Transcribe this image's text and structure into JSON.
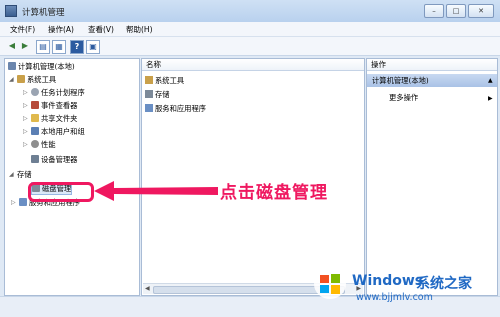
{
  "window": {
    "title": "计算机管理",
    "buttons": [
      "–",
      "□",
      "✕"
    ]
  },
  "menu": [
    {
      "label": "文件(F)"
    },
    {
      "label": "操作(A)"
    },
    {
      "label": "查看(V)"
    },
    {
      "label": "帮助(H)"
    }
  ],
  "tree": {
    "root": "计算机管理(本地)",
    "items": [
      {
        "label": "系统工具"
      },
      {
        "label": "任务计划程序"
      },
      {
        "label": "事件查看器"
      },
      {
        "label": "共享文件夹"
      },
      {
        "label": "本地用户和组"
      },
      {
        "label": "性能"
      },
      {
        "label": "设备管理器"
      },
      {
        "label": "存储"
      },
      {
        "label": "磁盘管理"
      },
      {
        "label": "服务和应用程序"
      }
    ]
  },
  "center": {
    "column_header": "名称",
    "rows": [
      {
        "label": "系统工具"
      },
      {
        "label": "存储"
      },
      {
        "label": "服务和应用程序"
      }
    ]
  },
  "actions": {
    "header": "操作",
    "section": "计算机管理(本地)",
    "more": "更多操作"
  },
  "annotation": "点击磁盘管理",
  "watermark": {
    "brand1": "Windows",
    "brand2": "系统之家",
    "url": "www.bjjmlv.com"
  },
  "colors": {
    "accent": "#ef1860",
    "watermark": "#2069c4"
  }
}
